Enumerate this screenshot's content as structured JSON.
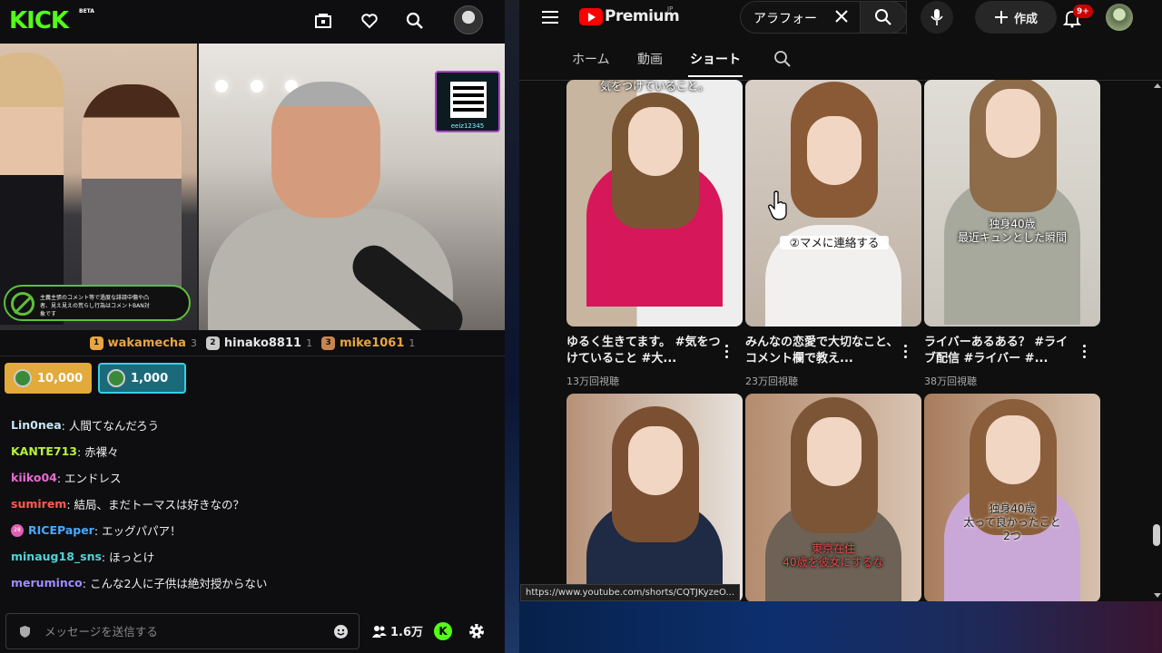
{
  "kick": {
    "logo": "KICK",
    "beta": "BETA",
    "qr_label": "eeiz12345",
    "warning_text": "主義主張のコメント等で過度な誹謗中傷や凸者、見え見えの荒らし行為はコメントBAN対象です",
    "top_gifters": [
      {
        "rank": "1",
        "name": "wakamecha",
        "count": "3",
        "color": "#e8a640"
      },
      {
        "rank": "2",
        "name": "hinako8811",
        "count": "1",
        "color": "#c9c9c9"
      },
      {
        "rank": "3",
        "name": "mike1061",
        "count": "1",
        "color": "#c98550"
      }
    ],
    "pills": [
      {
        "value": "10,000",
        "bg": "#e2a93b",
        "border": "#e2a93b"
      },
      {
        "value": "1,000",
        "bg": "#1b6a7a",
        "border": "#34d0e6"
      }
    ],
    "chat": [
      {
        "user": "Lin0nea",
        "text": ": 人間てなんだろう",
        "color": "#c8e6f5"
      },
      {
        "user": "KANTE713",
        "text": ": 赤裸々",
        "color": "#b8f23a"
      },
      {
        "user": "kiiko04",
        "text": ": エンドレス",
        "color": "#e86ad1"
      },
      {
        "user": "sumirem",
        "text": ": 結局、まだトーマスは好きなの？",
        "color": "#ff5a4e"
      },
      {
        "user": "RICEPaper",
        "text": ": エッグパパア！",
        "color": "#4aa8ff",
        "badge": "28"
      },
      {
        "user": "minaug18_sns",
        "text": ": ほっとけ",
        "color": "#4fd4d8"
      },
      {
        "user": "meruminco",
        "text": ": こんな2人に子供は絶対授からない",
        "color": "#9f8cff"
      }
    ],
    "input_placeholder": "メッセージを送信する",
    "viewers": "1.6万",
    "k_badge": "K"
  },
  "youtube": {
    "brand": "Premium",
    "region": "JP",
    "search_value": "アラフォー",
    "create_label": "作成",
    "notif_count": "9+",
    "tabs": [
      "ホーム",
      "動画",
      "ショート"
    ],
    "active_tab": "ショート",
    "shorts": [
      {
        "title": "ゆるく生きてます。 #気をつけていること #大...",
        "views": "13万回視聴",
        "top_caption": "気をつけていること。",
        "mid_caption": ""
      },
      {
        "title": "みんなの恋愛で大切なこと、コメント欄で教え...",
        "views": "23万回視聴",
        "top_caption": "",
        "mid_caption": "②マメに連絡する"
      },
      {
        "title": "ライバーあるある？ #ライブ配信 #ライバー #...",
        "views": "38万回視聴",
        "top_caption": "",
        "mid_caption": "独身40歳\n最近キュンとした瞬間"
      },
      {
        "title": "",
        "views": "",
        "top_caption": "",
        "mid_caption": ""
      },
      {
        "title": "",
        "views": "",
        "top_caption": "",
        "mid_caption": "東京在住\n40歳を彼女にするな"
      },
      {
        "title": "",
        "views": "",
        "top_caption": "",
        "mid_caption": "独身40歳\n太って良かったこと\n2つ"
      }
    ],
    "status_url": "https://www.youtube.com/shorts/CQTJKyzeO..."
  }
}
